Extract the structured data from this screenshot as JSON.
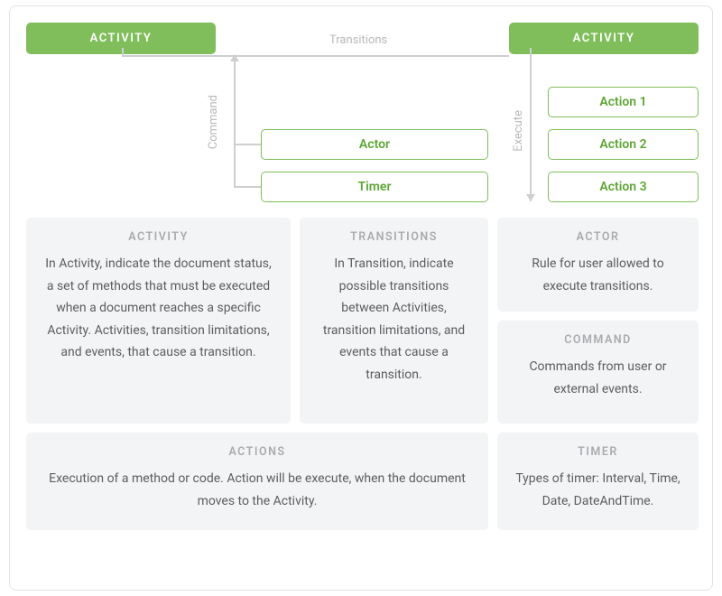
{
  "top": {
    "activity_left": "ACTIVITY",
    "activity_right": "ACTIVITY",
    "transitions_label": "Transitions",
    "command_label": "Command",
    "execute_label": "Execute",
    "actor": "Actor",
    "timer": "Timer",
    "actions": [
      "Action 1",
      "Action 2",
      "Action 3"
    ]
  },
  "cards": {
    "activity": {
      "title": "ACTIVITY",
      "body": "In Activity, indicate the document status, a set of methods that must be executed when a document reaches a specific Activity. Activities, transition limitations, and events, that cause a transition."
    },
    "transitions": {
      "title": "TRANSITIONS",
      "body": "In Transition, indicate possible transitions between Activities, transition limitations, and events that cause a transition."
    },
    "actor": {
      "title": "ACTOR",
      "body": "Rule for user allowed to execute transitions."
    },
    "command": {
      "title": "COMMAND",
      "body": "Commands from user or external events."
    },
    "actions": {
      "title": "ACTIONS",
      "body": "Execution of a method or code. Action will be execute, when the document moves to the Activity."
    },
    "timer": {
      "title": "TIMER",
      "body": "Types of timer: Interval, Time, Date, DateAndTime."
    }
  }
}
